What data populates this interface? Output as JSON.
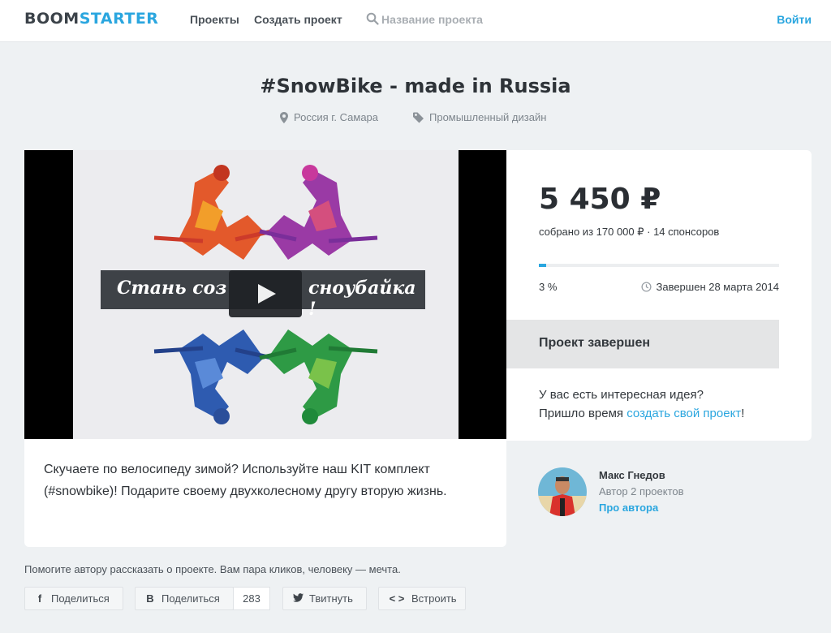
{
  "header": {
    "logo_part1": "BOOM",
    "logo_part2": "STARTER",
    "nav": [
      "Проекты",
      "Создать проект"
    ],
    "search_placeholder": "Название проекта",
    "login_label": "Войти"
  },
  "project": {
    "title": "#SnowBike - made in Russia",
    "location": "Россия г. Самара",
    "category": "Промышленный дизайн",
    "location_icon": "map-pin-icon",
    "category_icon": "tag-icon"
  },
  "video": {
    "banner_text": "Стань соз",
    "banner_text_end": "сноубайка !",
    "play_icon": "play-icon"
  },
  "funding": {
    "amount": "5 450 ₽",
    "raised_text": "собрано из 170 000 ₽ · 14 спонсоров",
    "progress_fraction": 0.03,
    "percent_label": "3 %",
    "ended_text": "Завершен 28 марта 2014",
    "clock_icon": "clock-icon",
    "status_label": "Проект завершен",
    "idea_line1": "У вас есть интересная идея?",
    "idea_line2_pre": "Пришло время ",
    "idea_link": "создать свой проект",
    "idea_line2_post": "!"
  },
  "description": "Скучаете по велосипеду зимой? Используйте наш KIT комплект (#snowbike)! Подарите своему двухколесному другу вторую жизнь.",
  "author": {
    "name": "Макс Гнедов",
    "projects": "Автор 2 проектов",
    "link": "Про автора"
  },
  "share": {
    "note": "Помогите автору рассказать о проекте. Вам пара кликов, человеку — мечта.",
    "buttons": [
      {
        "glyph": "f",
        "label": "Поделиться",
        "icon": "facebook-icon"
      },
      {
        "glyph": "B",
        "label": "Поделиться",
        "icon": "vk-icon"
      },
      {
        "glyph": "🐦",
        "label": "Твитнуть",
        "icon": "twitter-icon"
      },
      {
        "glyph": "< >",
        "label": "Встроить",
        "icon": "embed-icon"
      }
    ],
    "vk_count": "283"
  },
  "colors": {
    "accent": "#2aa6df",
    "background": "#eef1f3",
    "status_bar": "#e4e5e6"
  }
}
